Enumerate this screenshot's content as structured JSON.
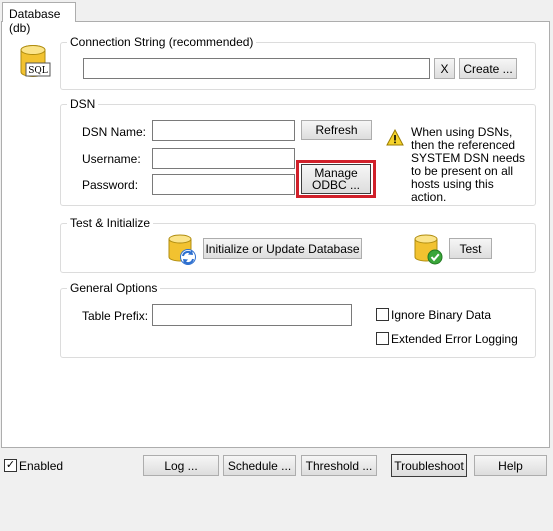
{
  "tab": {
    "label": "Database (db)"
  },
  "connection": {
    "title": "Connection String (recommended)",
    "value": "",
    "clear_label": "X",
    "create_label": "Create ..."
  },
  "dsn": {
    "title": "DSN",
    "name_label": "DSN Name:",
    "name_value": "",
    "refresh_label": "Refresh",
    "username_label": "Username:",
    "username_value": "",
    "password_label": "Password:",
    "password_value": "",
    "manage_line1": "Manage",
    "manage_line2": "ODBC ...",
    "warning_text": "When using DSNs, then the referenced SYSTEM DSN needs to be present on all hosts using this action."
  },
  "test": {
    "title": "Test & Initialize",
    "init_label": "Initialize or Update Database",
    "test_label": "Test"
  },
  "general": {
    "title": "General Options",
    "prefix_label": "Table Prefix:",
    "prefix_value": "",
    "ignore_binary_label": "Ignore Binary Data",
    "ignore_binary_checked": false,
    "extended_logging_label": "Extended Error Logging",
    "extended_logging_checked": false
  },
  "footer": {
    "enabled_label": "Enabled",
    "enabled_checked": true,
    "log_label": "Log ...",
    "schedule_label": "Schedule ...",
    "threshold_label": "Threshold ...",
    "troubleshoot_label": "Troubleshoot",
    "help_label": "Help"
  },
  "colors": {
    "highlight_border": "#d0202a",
    "db_icon_yellow": "#f2c230",
    "check_green": "#3aa63a",
    "sync_blue": "#2d6fcf"
  }
}
